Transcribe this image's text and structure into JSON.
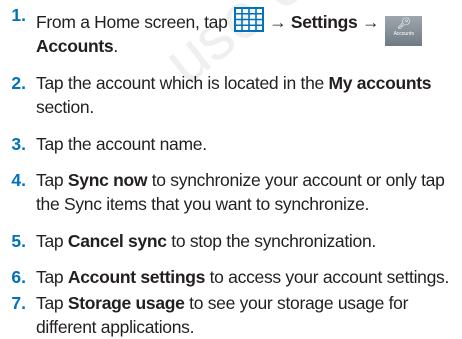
{
  "watermark": "use only",
  "steps": [
    {
      "number": "1.",
      "line1_before": "From a Home screen, tap",
      "arrow1": "→",
      "settings": "Settings",
      "arrow2": "→",
      "icon_label": "Accounts",
      "line2": "Accounts",
      "line2_end": "."
    },
    {
      "number": "2.",
      "before": "Tap the account which is located in the",
      "bold": "My accounts",
      "line2": "section."
    },
    {
      "number": "3.",
      "text": "Tap the account name."
    },
    {
      "number": "4.",
      "before": "Tap",
      "bold": "Sync now",
      "after": "to synchronize your account or only tap",
      "line2": "the Sync items that you want to synchronize."
    },
    {
      "number": "5.",
      "before": "Tap",
      "bold": "Cancel sync",
      "after": "to stop the synchronization."
    },
    {
      "number": "6.",
      "before": "Tap",
      "bold": "Account settings",
      "after": "to access your account settings."
    },
    {
      "number": "7.",
      "before": "Tap",
      "bold": "Storage usage",
      "after": "to see your storage usage for",
      "line2": "different applications."
    }
  ]
}
